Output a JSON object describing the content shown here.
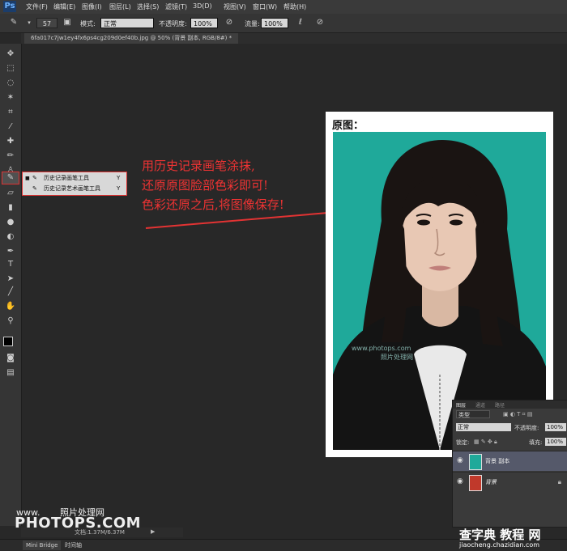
{
  "app": {
    "logo": "Ps"
  },
  "menu": [
    "文件(F)",
    "编辑(E)",
    "图像(I)",
    "图层(L)",
    "选择(S)",
    "滤镜(T)",
    "3D(D)",
    "视图(V)",
    "窗口(W)",
    "帮助(H)"
  ],
  "options": {
    "brush_size": "57",
    "mode_label": "模式:",
    "mode_value": "正常",
    "opacity_label": "不透明度:",
    "opacity_value": "100%",
    "flow_label": "流量:",
    "flow_value": "100%"
  },
  "document": {
    "tab_title": "6fa017c7jw1ey4fx6ps4cg209d0ef40b.jpg @ 50% (背景 副本, RGB/8#) *"
  },
  "tool_flyout": {
    "items": [
      {
        "label": "历史记录画笔工具",
        "shortcut": "Y",
        "selected": true
      },
      {
        "label": "历史记录艺术画笔工具",
        "shortcut": "Y",
        "selected": false
      }
    ]
  },
  "canvas": {
    "title": "原图：",
    "watermark_line1": "www.photops.com",
    "watermark_line2": "照片处理网"
  },
  "annotation": {
    "lines": [
      "用历史记录画笔涂抹,",
      "还原原图脸部色彩即可!",
      "色彩还原之后,将图像保存!"
    ],
    "color": "#e33333"
  },
  "layers_panel": {
    "tabs": [
      "图层",
      "通道",
      "路径"
    ],
    "filter_label": "类型",
    "blend_mode": "正常",
    "opacity_label": "不透明度:",
    "opacity_value": "100%",
    "lock_label": "锁定:",
    "fill_label": "填充:",
    "fill_value": "100%",
    "layers": [
      {
        "name": "背景 副本",
        "selected": true,
        "locked": false
      },
      {
        "name": "背景",
        "selected": false,
        "locked": true
      }
    ]
  },
  "status": {
    "doc_info": "文档:1.37M/6.37M"
  },
  "bottom_tabs": [
    "Mini Bridge",
    "时间轴"
  ],
  "watermarks": {
    "site_small": "www.",
    "site_cn": "照片处理网",
    "site_big": "PHOTOPS.COM",
    "corner_cn": "查字典 教程 网",
    "corner_url": "jiaocheng.chazidian.com"
  }
}
